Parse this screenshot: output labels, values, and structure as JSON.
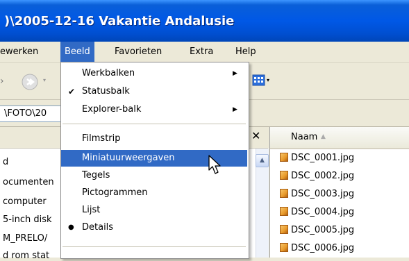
{
  "window": {
    "title": ")\\2005-12-16 Vakantie Andalusie"
  },
  "menubar": {
    "items": [
      {
        "label": "ewerken",
        "active": false
      },
      {
        "label": "Beeld",
        "active": true
      },
      {
        "label": "Favorieten",
        "active": false
      },
      {
        "label": "Extra",
        "active": false
      },
      {
        "label": "Help",
        "active": false
      }
    ]
  },
  "toolbar": {
    "back_icon": "chevron-left-icon",
    "forward_icon": "forward-arrow-icon",
    "views_icon": "views-icon"
  },
  "addressbar": {
    "value": "\\FOTO\\20"
  },
  "left_pane": {
    "close_label": "✕",
    "tree": [
      "d",
      "ocumenten",
      "computer",
      "5-inch disk",
      "M_PRELO/",
      "d rom stat"
    ]
  },
  "right_pane": {
    "column_header": "Naam",
    "files": [
      "DSC_0001.jpg",
      "DSC_0002.jpg",
      "DSC_0003.jpg",
      "DSC_0004.jpg",
      "DSC_0005.jpg",
      "DSC_0006.jpg"
    ]
  },
  "view_menu": {
    "groups": [
      [
        {
          "label": "Werkbalken",
          "check": "",
          "submenu": true,
          "highlighted": false
        },
        {
          "label": "Statusbalk",
          "check": "✔",
          "submenu": false,
          "highlighted": false
        },
        {
          "label": "Explorer-balk",
          "check": "",
          "submenu": true,
          "highlighted": false
        }
      ],
      [
        {
          "label": "Filmstrip",
          "check": "",
          "submenu": false,
          "highlighted": false
        },
        {
          "label": "Miniatuurweergaven",
          "check": "",
          "submenu": false,
          "highlighted": true
        },
        {
          "label": "Tegels",
          "check": "",
          "submenu": false,
          "highlighted": false
        },
        {
          "label": "Pictogrammen",
          "check": "",
          "submenu": false,
          "highlighted": false
        },
        {
          "label": "Lijst",
          "check": "",
          "submenu": false,
          "highlighted": false
        },
        {
          "label": "Details",
          "check": "●",
          "submenu": false,
          "highlighted": false
        }
      ]
    ]
  },
  "colors": {
    "menu_highlight": "#316ac5",
    "title_blue": "#0058e6"
  }
}
